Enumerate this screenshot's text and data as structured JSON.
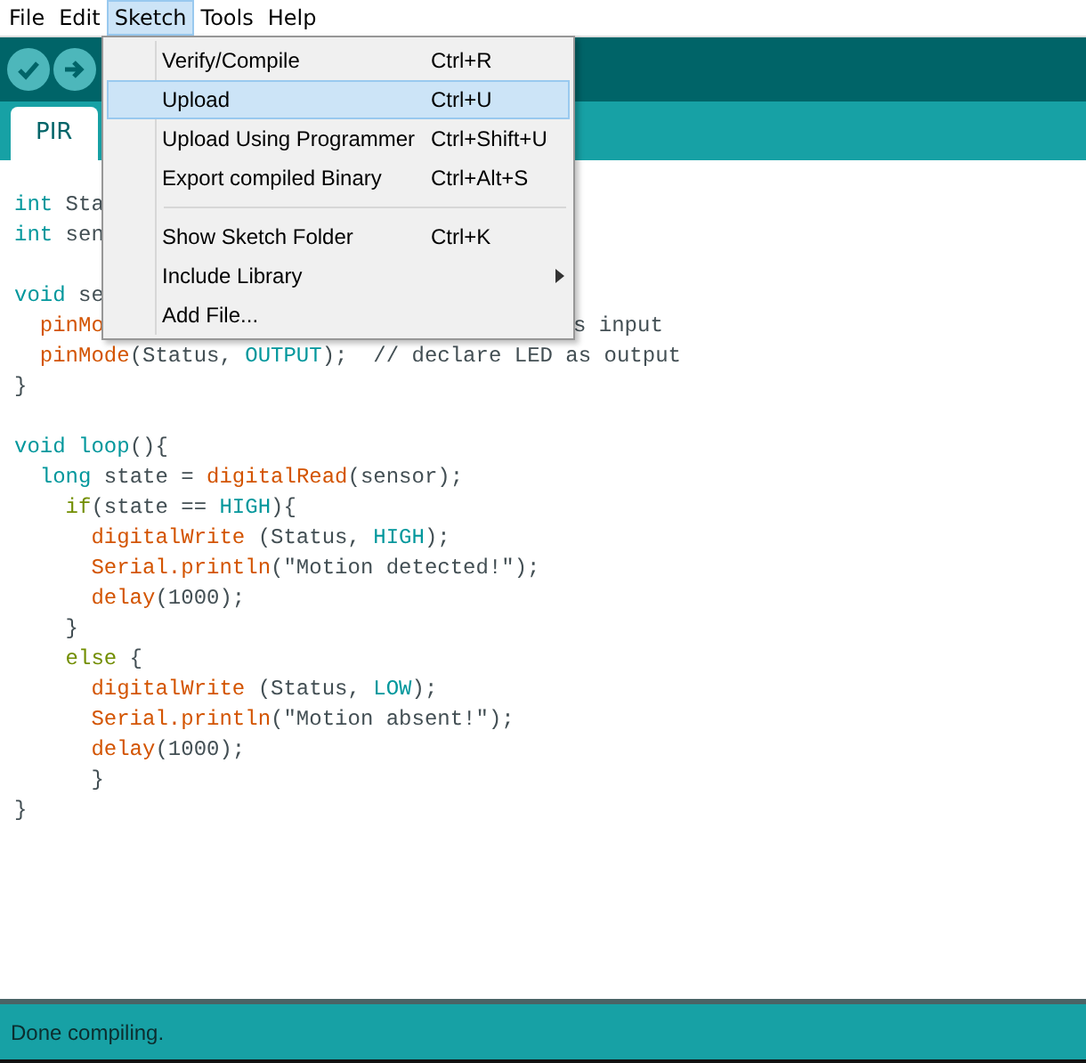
{
  "menubar": [
    {
      "label": "File",
      "selected": false
    },
    {
      "label": "Edit",
      "selected": false
    },
    {
      "label": "Sketch",
      "selected": true
    },
    {
      "label": "Tools",
      "selected": false
    },
    {
      "label": "Help",
      "selected": false
    }
  ],
  "toolbar": [
    {
      "kind": "verify"
    },
    {
      "kind": "upload"
    }
  ],
  "tabs": [
    {
      "label": "PIR",
      "selected": true
    }
  ],
  "code": [
    {
      "kind": "code",
      "tokens": [
        {
          "color": "#00979c",
          "t": "int"
        },
        {
          "color": "#434f54",
          "t": " Sta"
        }
      ]
    },
    {
      "kind": "code",
      "tokens": [
        {
          "color": "#00979c",
          "t": "int"
        },
        {
          "color": "#434f54",
          "t": " sen"
        }
      ]
    },
    {
      "kind": "blank"
    },
    {
      "kind": "code",
      "tokens": [
        {
          "color": "#00979c",
          "t": "void"
        },
        {
          "color": "#434f54",
          "t": " se"
        }
      ]
    },
    {
      "kind": "code",
      "tokens": [
        {
          "color": "#d35400",
          "t": "  pinMo"
        }
      ],
      "after_menu": [
        {
          "color": "#434f54",
          "t": "s input"
        }
      ]
    },
    {
      "kind": "code",
      "tokens": [
        {
          "color": "#d35400",
          "t": "  pinMode"
        },
        {
          "color": "#434f54",
          "t": "(Status, "
        },
        {
          "color": "#00979c",
          "t": "OUTPUT"
        },
        {
          "color": "#434f54",
          "t": ");  // declare LED as output"
        }
      ]
    },
    {
      "kind": "code",
      "tokens": [
        {
          "color": "#434f54",
          "t": "}"
        }
      ]
    },
    {
      "kind": "blank"
    },
    {
      "kind": "code",
      "tokens": [
        {
          "color": "#00979c",
          "t": "void loop"
        },
        {
          "color": "#434f54",
          "t": "(){"
        }
      ]
    },
    {
      "kind": "code",
      "tokens": [
        {
          "color": "#00979c",
          "t": "  long"
        },
        {
          "color": "#434f54",
          "t": " state = "
        },
        {
          "color": "#d35400",
          "t": "digitalRead"
        },
        {
          "color": "#434f54",
          "t": "(sensor);"
        }
      ]
    },
    {
      "kind": "code",
      "tokens": [
        {
          "color": "#728e00",
          "t": "    if"
        },
        {
          "color": "#434f54",
          "t": "(state == "
        },
        {
          "color": "#00979c",
          "t": "HIGH"
        },
        {
          "color": "#434f54",
          "t": "){"
        }
      ]
    },
    {
      "kind": "code",
      "tokens": [
        {
          "color": "#d35400",
          "t": "      digitalWrite"
        },
        {
          "color": "#434f54",
          "t": " (Status, "
        },
        {
          "color": "#00979c",
          "t": "HIGH"
        },
        {
          "color": "#434f54",
          "t": ");"
        }
      ]
    },
    {
      "kind": "code",
      "tokens": [
        {
          "color": "#d35400",
          "t": "      Serial.println"
        },
        {
          "color": "#434f54",
          "t": "(\"Motion detected!\");"
        }
      ]
    },
    {
      "kind": "code",
      "tokens": [
        {
          "color": "#d35400",
          "t": "      delay"
        },
        {
          "color": "#434f54",
          "t": "(1000);"
        }
      ]
    },
    {
      "kind": "code",
      "tokens": [
        {
          "color": "#434f54",
          "t": "    }"
        }
      ]
    },
    {
      "kind": "code",
      "tokens": [
        {
          "color": "#728e00",
          "t": "    else"
        },
        {
          "color": "#434f54",
          "t": " {"
        }
      ]
    },
    {
      "kind": "code",
      "tokens": [
        {
          "color": "#d35400",
          "t": "      digitalWrite"
        },
        {
          "color": "#434f54",
          "t": " (Status, "
        },
        {
          "color": "#00979c",
          "t": "LOW"
        },
        {
          "color": "#434f54",
          "t": ");"
        }
      ]
    },
    {
      "kind": "code",
      "tokens": [
        {
          "color": "#d35400",
          "t": "      Serial.println"
        },
        {
          "color": "#434f54",
          "t": "(\"Motion absent!\");"
        }
      ]
    },
    {
      "kind": "code",
      "tokens": [
        {
          "color": "#d35400",
          "t": "      delay"
        },
        {
          "color": "#434f54",
          "t": "(1000);"
        }
      ]
    },
    {
      "kind": "code",
      "tokens": [
        {
          "color": "#434f54",
          "t": "      }"
        }
      ]
    },
    {
      "kind": "code",
      "tokens": [
        {
          "color": "#434f54",
          "t": "}"
        }
      ]
    }
  ],
  "menu": {
    "items": [
      {
        "kind": "item",
        "label": "Verify/Compile",
        "shortcut": "Ctrl+R",
        "selected": false
      },
      {
        "kind": "item",
        "label": "Upload",
        "shortcut": "Ctrl+U",
        "selected": true
      },
      {
        "kind": "item",
        "label": "Upload Using Programmer",
        "shortcut": "Ctrl+Shift+U",
        "selected": false
      },
      {
        "kind": "item",
        "label": "Export compiled Binary",
        "shortcut": "Ctrl+Alt+S",
        "selected": false
      },
      {
        "kind": "separator"
      },
      {
        "kind": "item",
        "label": "Show Sketch Folder",
        "shortcut": "Ctrl+K",
        "selected": false
      },
      {
        "kind": "submenu",
        "label": "Include Library",
        "selected": false
      },
      {
        "kind": "item",
        "label": "Add File...",
        "selected": false
      }
    ]
  },
  "status_bar": {
    "message": "Done compiling."
  }
}
